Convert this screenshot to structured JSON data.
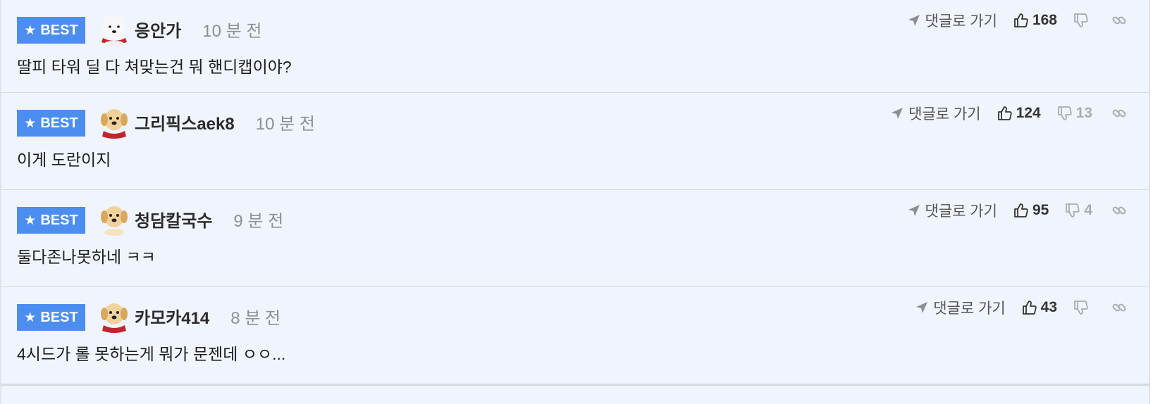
{
  "badge_label": "BEST",
  "reply_label": "댓글로 가기",
  "comments": [
    {
      "nickname": "응안가",
      "time": "10 분 전",
      "text": "딸피 타워 딜 다 쳐맞는건 뭐 핸디캡이야?",
      "up": "168",
      "down": "",
      "avatar": "polar-bear"
    },
    {
      "nickname": "그리픽스aek8",
      "time": "10 분 전",
      "text": "이게 도란이지",
      "up": "124",
      "down": "13",
      "avatar": "puppy"
    },
    {
      "nickname": "청담칼국수",
      "time": "9 분 전",
      "text": "둘다존나못하네 ㅋㅋ",
      "up": "95",
      "down": "4",
      "avatar": "puppy"
    },
    {
      "nickname": "카모카414",
      "time": "8 분 전",
      "text": "4시드가 롤 못하는게 뭐가 문젠데 ㅇㅇ...",
      "up": "43",
      "down": "",
      "avatar": "puppy"
    }
  ],
  "colors": {
    "badge": "#4b8ef0",
    "background": "#f0f4fd"
  }
}
